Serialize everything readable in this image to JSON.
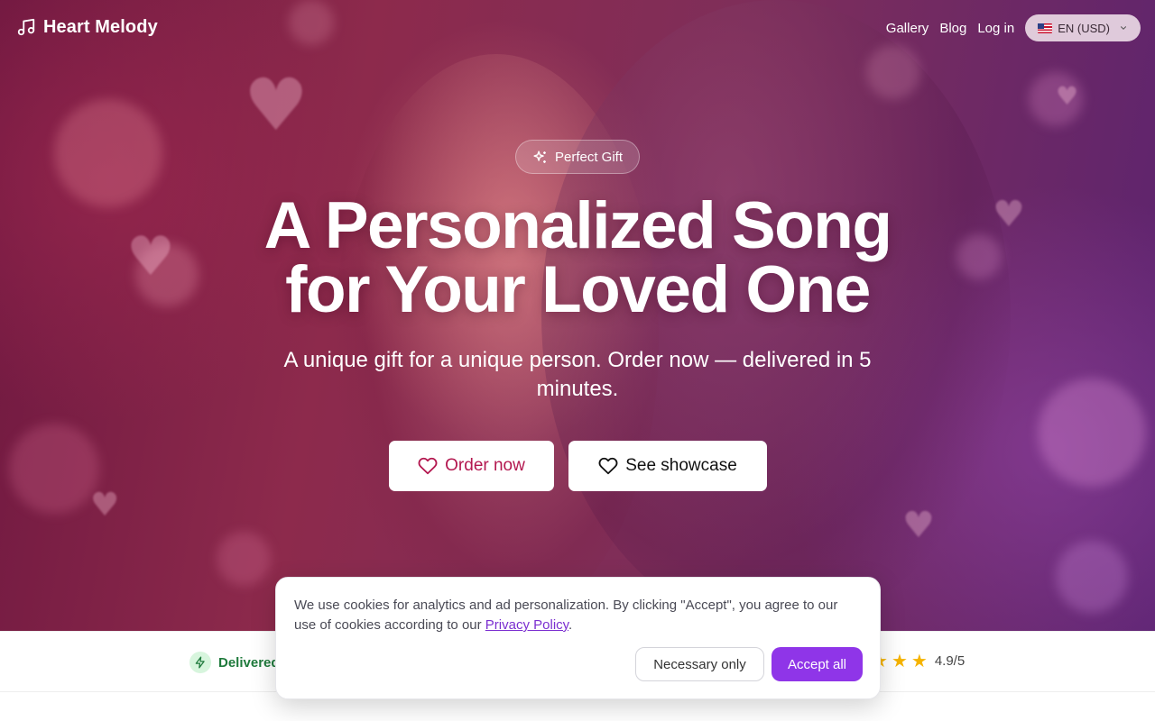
{
  "brand": {
    "name": "Heart Melody",
    "icon": "music-note-icon"
  },
  "nav": {
    "links": [
      "Gallery",
      "Blog",
      "Log in"
    ],
    "language": "EN (USD)",
    "language_flag": "us-flag-icon"
  },
  "hero": {
    "badge": "Perfect Gift",
    "title_line1": "A Personalized Song",
    "title_line2": "for Your Loved One",
    "subtitle": "A unique gift for a unique person. Order now — delivered in 5 minutes.",
    "order_button": "Order now",
    "showcase_button": "See showcase"
  },
  "stats": {
    "delivered_label": "Delivered",
    "rating": "4.9/5",
    "stars_shown": 3
  },
  "cookie": {
    "text": "We use cookies for analytics and ad personalization. By clicking \"Accept\", you agree to our use of cookies according to our ",
    "link": "Privacy Policy",
    "end": ".",
    "necessary_button": "Necessary only",
    "accept_button": "Accept all"
  },
  "colors": {
    "accent_purple": "#8f35e8",
    "order_text": "#b3174f",
    "delivered_green": "#1f7a3c",
    "star": "#f5b301"
  }
}
